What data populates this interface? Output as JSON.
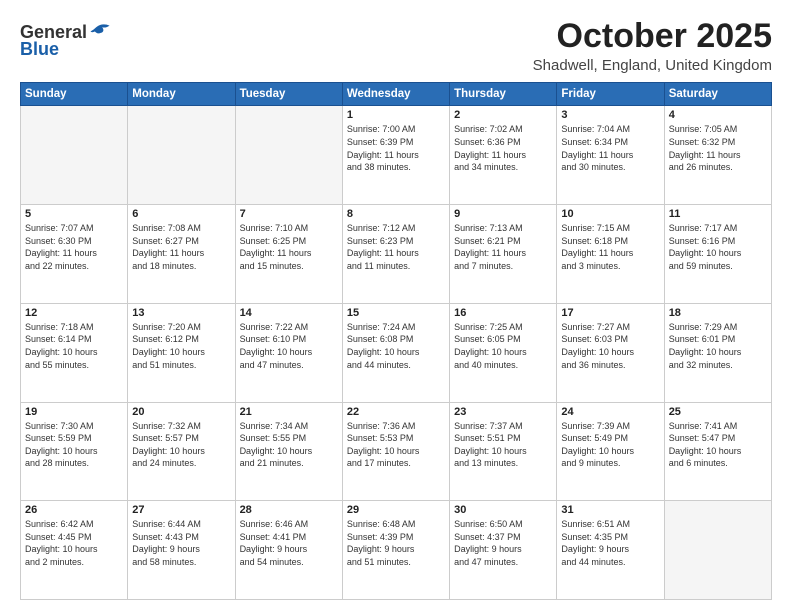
{
  "header": {
    "logo_line1": "General",
    "logo_line2": "Blue",
    "month": "October 2025",
    "location": "Shadwell, England, United Kingdom"
  },
  "weekdays": [
    "Sunday",
    "Monday",
    "Tuesday",
    "Wednesday",
    "Thursday",
    "Friday",
    "Saturday"
  ],
  "weeks": [
    [
      {
        "day": "",
        "text": ""
      },
      {
        "day": "",
        "text": ""
      },
      {
        "day": "",
        "text": ""
      },
      {
        "day": "1",
        "text": "Sunrise: 7:00 AM\nSunset: 6:39 PM\nDaylight: 11 hours\nand 38 minutes."
      },
      {
        "day": "2",
        "text": "Sunrise: 7:02 AM\nSunset: 6:36 PM\nDaylight: 11 hours\nand 34 minutes."
      },
      {
        "day": "3",
        "text": "Sunrise: 7:04 AM\nSunset: 6:34 PM\nDaylight: 11 hours\nand 30 minutes."
      },
      {
        "day": "4",
        "text": "Sunrise: 7:05 AM\nSunset: 6:32 PM\nDaylight: 11 hours\nand 26 minutes."
      }
    ],
    [
      {
        "day": "5",
        "text": "Sunrise: 7:07 AM\nSunset: 6:30 PM\nDaylight: 11 hours\nand 22 minutes."
      },
      {
        "day": "6",
        "text": "Sunrise: 7:08 AM\nSunset: 6:27 PM\nDaylight: 11 hours\nand 18 minutes."
      },
      {
        "day": "7",
        "text": "Sunrise: 7:10 AM\nSunset: 6:25 PM\nDaylight: 11 hours\nand 15 minutes."
      },
      {
        "day": "8",
        "text": "Sunrise: 7:12 AM\nSunset: 6:23 PM\nDaylight: 11 hours\nand 11 minutes."
      },
      {
        "day": "9",
        "text": "Sunrise: 7:13 AM\nSunset: 6:21 PM\nDaylight: 11 hours\nand 7 minutes."
      },
      {
        "day": "10",
        "text": "Sunrise: 7:15 AM\nSunset: 6:18 PM\nDaylight: 11 hours\nand 3 minutes."
      },
      {
        "day": "11",
        "text": "Sunrise: 7:17 AM\nSunset: 6:16 PM\nDaylight: 10 hours\nand 59 minutes."
      }
    ],
    [
      {
        "day": "12",
        "text": "Sunrise: 7:18 AM\nSunset: 6:14 PM\nDaylight: 10 hours\nand 55 minutes."
      },
      {
        "day": "13",
        "text": "Sunrise: 7:20 AM\nSunset: 6:12 PM\nDaylight: 10 hours\nand 51 minutes."
      },
      {
        "day": "14",
        "text": "Sunrise: 7:22 AM\nSunset: 6:10 PM\nDaylight: 10 hours\nand 47 minutes."
      },
      {
        "day": "15",
        "text": "Sunrise: 7:24 AM\nSunset: 6:08 PM\nDaylight: 10 hours\nand 44 minutes."
      },
      {
        "day": "16",
        "text": "Sunrise: 7:25 AM\nSunset: 6:05 PM\nDaylight: 10 hours\nand 40 minutes."
      },
      {
        "day": "17",
        "text": "Sunrise: 7:27 AM\nSunset: 6:03 PM\nDaylight: 10 hours\nand 36 minutes."
      },
      {
        "day": "18",
        "text": "Sunrise: 7:29 AM\nSunset: 6:01 PM\nDaylight: 10 hours\nand 32 minutes."
      }
    ],
    [
      {
        "day": "19",
        "text": "Sunrise: 7:30 AM\nSunset: 5:59 PM\nDaylight: 10 hours\nand 28 minutes."
      },
      {
        "day": "20",
        "text": "Sunrise: 7:32 AM\nSunset: 5:57 PM\nDaylight: 10 hours\nand 24 minutes."
      },
      {
        "day": "21",
        "text": "Sunrise: 7:34 AM\nSunset: 5:55 PM\nDaylight: 10 hours\nand 21 minutes."
      },
      {
        "day": "22",
        "text": "Sunrise: 7:36 AM\nSunset: 5:53 PM\nDaylight: 10 hours\nand 17 minutes."
      },
      {
        "day": "23",
        "text": "Sunrise: 7:37 AM\nSunset: 5:51 PM\nDaylight: 10 hours\nand 13 minutes."
      },
      {
        "day": "24",
        "text": "Sunrise: 7:39 AM\nSunset: 5:49 PM\nDaylight: 10 hours\nand 9 minutes."
      },
      {
        "day": "25",
        "text": "Sunrise: 7:41 AM\nSunset: 5:47 PM\nDaylight: 10 hours\nand 6 minutes."
      }
    ],
    [
      {
        "day": "26",
        "text": "Sunrise: 6:42 AM\nSunset: 4:45 PM\nDaylight: 10 hours\nand 2 minutes."
      },
      {
        "day": "27",
        "text": "Sunrise: 6:44 AM\nSunset: 4:43 PM\nDaylight: 9 hours\nand 58 minutes."
      },
      {
        "day": "28",
        "text": "Sunrise: 6:46 AM\nSunset: 4:41 PM\nDaylight: 9 hours\nand 54 minutes."
      },
      {
        "day": "29",
        "text": "Sunrise: 6:48 AM\nSunset: 4:39 PM\nDaylight: 9 hours\nand 51 minutes."
      },
      {
        "day": "30",
        "text": "Sunrise: 6:50 AM\nSunset: 4:37 PM\nDaylight: 9 hours\nand 47 minutes."
      },
      {
        "day": "31",
        "text": "Sunrise: 6:51 AM\nSunset: 4:35 PM\nDaylight: 9 hours\nand 44 minutes."
      },
      {
        "day": "",
        "text": ""
      }
    ]
  ]
}
